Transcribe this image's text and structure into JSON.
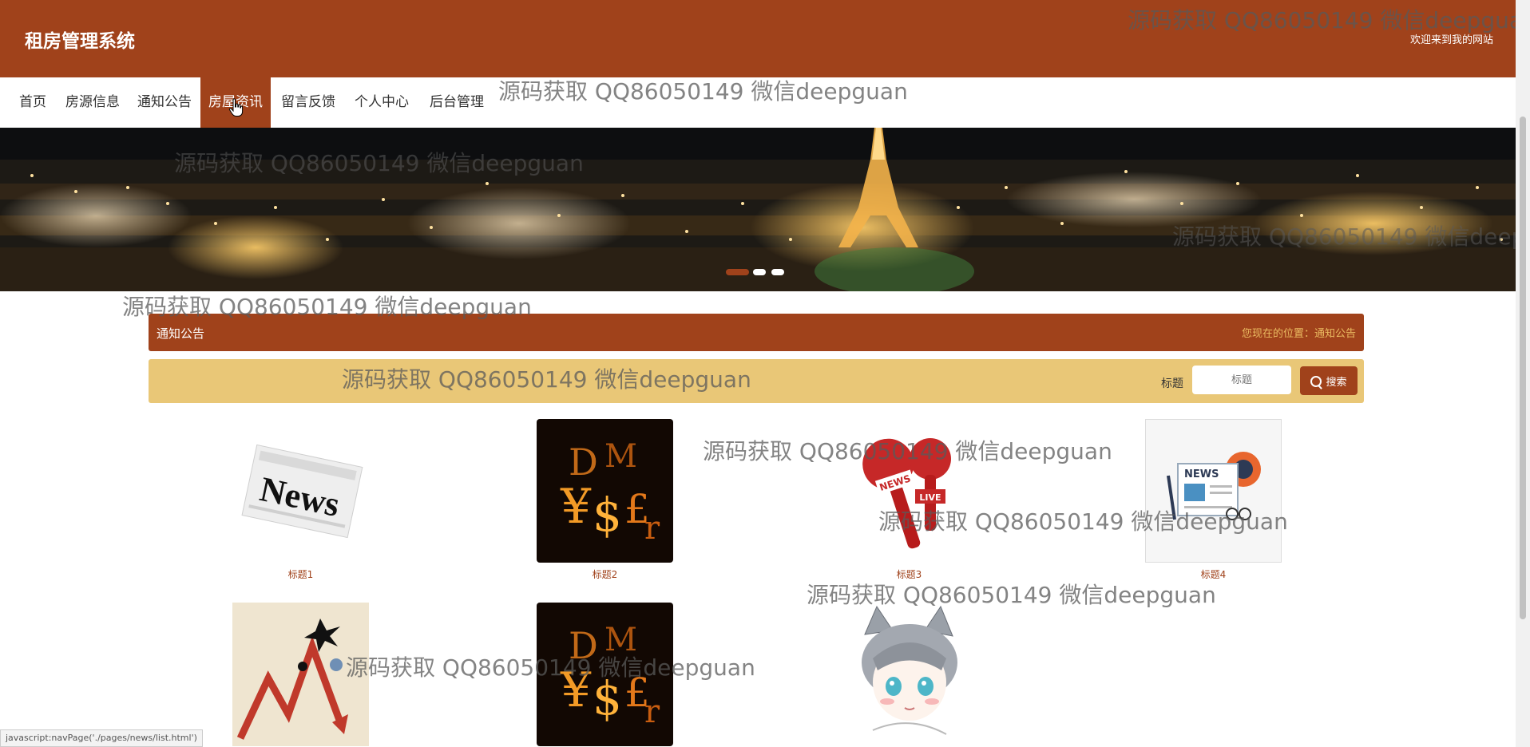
{
  "header": {
    "site_title": "租房管理系统",
    "welcome": "欢迎来到我的网站"
  },
  "nav": {
    "items": [
      {
        "label": "首页",
        "active": false
      },
      {
        "label": "房源信息",
        "active": false
      },
      {
        "label": "通知公告",
        "active": false
      },
      {
        "label": "房屋资讯",
        "active": true
      },
      {
        "label": "留言反馈",
        "active": false
      },
      {
        "label": "个人中心",
        "active": false
      },
      {
        "label": "后台管理",
        "active": false
      }
    ]
  },
  "banner": {
    "slide_count": 3,
    "active_slide": 1
  },
  "section": {
    "title": "通知公告",
    "breadcrumb": "您现在的位置：通知公告"
  },
  "search": {
    "label": "标题",
    "placeholder": "标题",
    "button_label": "搜索"
  },
  "news": [
    {
      "title": "标题1",
      "image": "newspaper-image"
    },
    {
      "title": "标题2",
      "image": "currency-image"
    },
    {
      "title": "标题3",
      "image": "microphone-image"
    },
    {
      "title": "标题4",
      "image": "news-icon-image"
    },
    {
      "title": "",
      "image": "falling-chart-image"
    },
    {
      "title": "",
      "image": "currency-image"
    },
    {
      "title": "",
      "image": "anime-cat-boy-image"
    }
  ],
  "watermark_text": "源码获取 QQ86050149 微信deepguan",
  "status_bar": {
    "url": "javascript:navPage('./pages/news/list.html')"
  },
  "colors": {
    "primary": "#a0421b",
    "search_bar": "#e9c777",
    "breadcrumb": "#ebbc62"
  }
}
